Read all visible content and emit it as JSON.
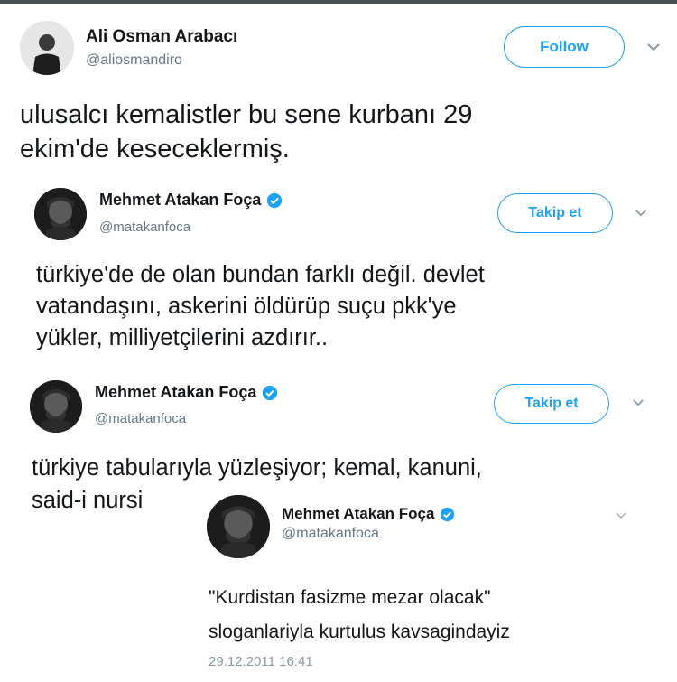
{
  "tweet1": {
    "name": "Ali Osman Arabacı",
    "handle": "@aliosmandiro",
    "follow_label": "Follow",
    "text_lines": [
      "ulusalcı kemalistler bu sene kurbanı 29",
      "ekim'de keseceklermiş."
    ]
  },
  "tweet2": {
    "name": "Mehmet Atakan Foça",
    "handle": "@matakanfoca",
    "follow_label": "Takip et",
    "text_lines": [
      "türkiye'de de olan bundan farklı değil. devlet",
      "vatandaşını, askerini öldürüp suçu pkk'ye",
      "yükler, milliyetçilerini azdırır.."
    ]
  },
  "tweet3": {
    "name": "Mehmet Atakan Foça",
    "handle": "@matakanfoca",
    "follow_label": "Takip et",
    "text_lines": [
      "türkiye tabularıyla yüzleşiyor; kemal, kanuni,",
      "said-i nursi"
    ]
  },
  "tweet4": {
    "name": "Mehmet Atakan Foça",
    "handle": "@matakanfoca",
    "text_lines": [
      "\"Kurdistan fasizme mezar olacak\"",
      "sloganlariyla kurtulus kavsagindayiz"
    ],
    "timestamp": "29.12.2011 16:41"
  },
  "colors": {
    "accent": "#1da1f2",
    "text": "#14171a",
    "secondary": "#657786",
    "chevron": "#8899a6"
  },
  "icons": [
    "avatar",
    "verified-badge-icon",
    "chevron-down-icon"
  ]
}
